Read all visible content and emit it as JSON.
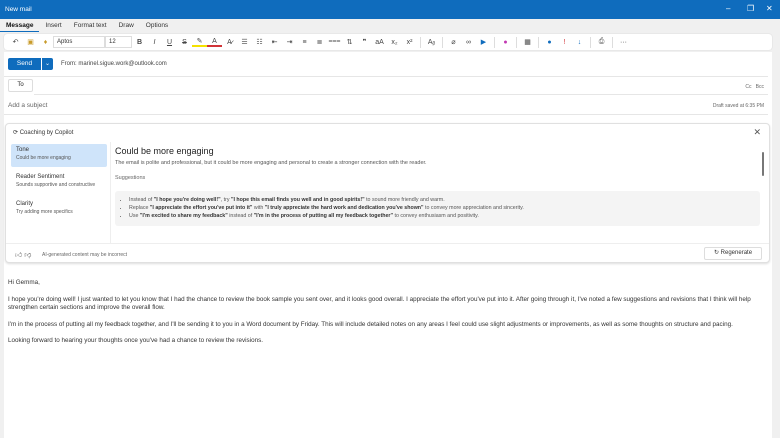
{
  "window": {
    "title": "New mail",
    "minimize": "–",
    "restore": "❐",
    "close": "✕"
  },
  "tabs": [
    "Message",
    "Insert",
    "Format text",
    "Draw",
    "Options"
  ],
  "toolbar": {
    "font": "Aptos",
    "size": "12",
    "more": "···"
  },
  "compose": {
    "send": "Send",
    "from": "From: marinel.sigue.work@outlook.com",
    "to": "To",
    "cc": "Cc",
    "bcc": "Bcc",
    "subject_placeholder": "Add a subject",
    "draft": "Draft saved at 6:35 PM"
  },
  "copilot": {
    "title": "Coaching by Copilot",
    "categories": [
      {
        "name": "Tone",
        "sub": "Could be more engaging"
      },
      {
        "name": "Reader Sentiment",
        "sub": "Sounds supportive and constructive"
      },
      {
        "name": "Clarity",
        "sub": "Try adding more specifics"
      }
    ],
    "heading": "Could be more engaging",
    "description": "The email is polite and professional, but it could be more engaging and personal to create a stronger connection with the reader.",
    "suggestions_label": "Suggestions",
    "suggestions": [
      {
        "p1": "Instead of ",
        "q1": "\"I hope you're doing well!\"",
        "p2": ", try ",
        "q2": "\"I hope this email finds you well and in good spirits!\"",
        "p3": " to sound more friendly and warm."
      },
      {
        "p1": "Replace ",
        "q1": "\"I appreciate the effort you've put into it\"",
        "p2": " with ",
        "q2": "\"I truly appreciate the hard work and dedication you've shown\"",
        "p3": " to convey more appreciation and sincerity."
      },
      {
        "p1": "Use ",
        "q1": "\"I'm excited to share my feedback\"",
        "p2": " instead of ",
        "q2": "\"I'm in the process of putting all my feedback together\"",
        "p3": " to convey enthusiasm and positivity."
      }
    ],
    "disclaimer": "AI-generated content may be incorrect",
    "regenerate": "Regenerate"
  },
  "body": [
    "Hi Gemma,",
    "I hope you're doing well! I just wanted to let you know that I had the chance to review the book sample you sent over, and it looks good overall. I appreciate the effort you've put into it. After going through it, I've noted a few suggestions and revisions that I think will help strengthen certain sections and improve the overall flow.",
    "I'm in the process of putting all my feedback together, and I'll be sending it to you in a Word document by Friday. This will include detailed notes on any areas I feel could use slight adjustments or improvements, as well as some thoughts on structure and pacing.",
    "Looking forward to hearing your thoughts once you've had a chance to review the revisions."
  ]
}
